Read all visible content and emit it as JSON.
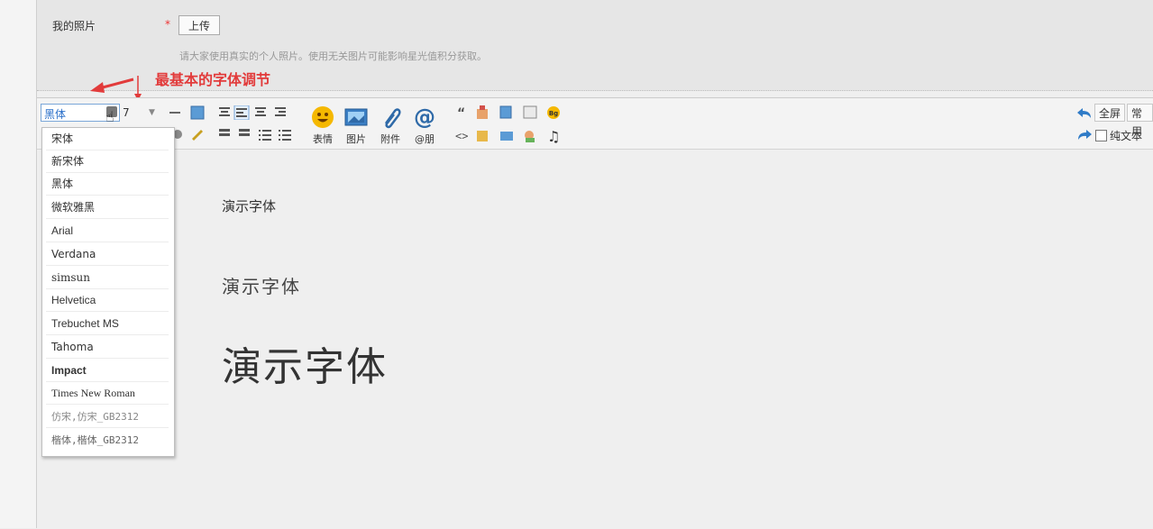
{
  "form": {
    "photo_label": "我的照片",
    "required_mark": "*",
    "upload_button": "上传",
    "hint": "请大家使用真实的个人照片。使用无关图片可能影响星光值积分获取。"
  },
  "annotation": "最基本的字体调节",
  "toolbar": {
    "font_value": "黑体",
    "size_value": "7",
    "emoji_label": "表情",
    "image_label": "图片",
    "attach_label": "附件",
    "mention_label": "@朋",
    "fullscreen_label": "全屏",
    "common_label": "常用",
    "plaintext_label": "纯文本"
  },
  "font_options": [
    "宋体",
    "新宋体",
    "黑体",
    "微软雅黑",
    "Arial",
    "Verdana",
    "simsun",
    "Helvetica",
    "Trebuchet MS",
    "Tahoma",
    "Impact",
    "Times New Roman",
    "仿宋,仿宋_GB2312",
    "楷体,楷体_GB2312"
  ],
  "content": {
    "demo_small": "演示字体",
    "demo_medium": "演示字体",
    "demo_large": "演示字体"
  },
  "colors": {
    "annotation": "#e23b3b",
    "select_border": "#7aa7d8",
    "select_text": "#2a6fc9"
  }
}
